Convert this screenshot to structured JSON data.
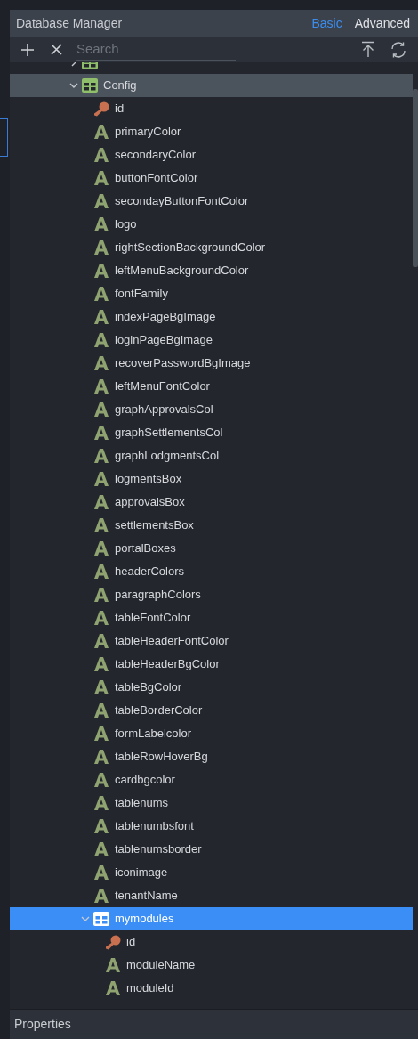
{
  "panel": {
    "title": "Database Manager"
  },
  "tabs": [
    {
      "label": "Basic",
      "selected": true
    },
    {
      "label": "Advanced",
      "selected": false
    }
  ],
  "search": {
    "placeholder": "Search"
  },
  "tree": [
    {
      "kind": "table",
      "expanded": false,
      "selected": false,
      "highlighted": false
    },
    {
      "kind": "table",
      "label": "Config",
      "expanded": true,
      "selected": false,
      "highlighted": true,
      "children": [
        {
          "kind": "key",
          "label": "id"
        },
        {
          "kind": "text",
          "label": "primaryColor"
        },
        {
          "kind": "text",
          "label": "secondaryColor"
        },
        {
          "kind": "text",
          "label": "buttonFontColor"
        },
        {
          "kind": "text",
          "label": "secondayButtonFontColor"
        },
        {
          "kind": "text",
          "label": "logo"
        },
        {
          "kind": "text",
          "label": "rightSectionBackgroundColor"
        },
        {
          "kind": "text",
          "label": "leftMenuBackgroundColor"
        },
        {
          "kind": "text",
          "label": "fontFamily"
        },
        {
          "kind": "text",
          "label": "indexPageBgImage"
        },
        {
          "kind": "text",
          "label": "loginPageBgImage"
        },
        {
          "kind": "text",
          "label": "recoverPasswordBgImage"
        },
        {
          "kind": "text",
          "label": "leftMenuFontColor"
        },
        {
          "kind": "text",
          "label": "graphApprovalsCol"
        },
        {
          "kind": "text",
          "label": "graphSettlementsCol"
        },
        {
          "kind": "text",
          "label": "graphLodgmentsCol"
        },
        {
          "kind": "text",
          "label": "logmentsBox"
        },
        {
          "kind": "text",
          "label": "approvalsBox"
        },
        {
          "kind": "text",
          "label": "settlementsBox"
        },
        {
          "kind": "text",
          "label": "portalBoxes"
        },
        {
          "kind": "text",
          "label": "headerColors"
        },
        {
          "kind": "text",
          "label": "paragraphColors"
        },
        {
          "kind": "text",
          "label": "tableFontColor"
        },
        {
          "kind": "text",
          "label": "tableHeaderFontColor"
        },
        {
          "kind": "text",
          "label": "tableHeaderBgColor"
        },
        {
          "kind": "text",
          "label": "tableBgColor"
        },
        {
          "kind": "text",
          "label": "tableBorderColor"
        },
        {
          "kind": "text",
          "label": "formLabelcolor"
        },
        {
          "kind": "text",
          "label": "tableRowHoverBg"
        },
        {
          "kind": "text",
          "label": "cardbgcolor"
        },
        {
          "kind": "text",
          "label": "tablenums"
        },
        {
          "kind": "text",
          "label": "tablenumbsfont"
        },
        {
          "kind": "text",
          "label": "tablenumsborder"
        },
        {
          "kind": "text",
          "label": "iconimage"
        },
        {
          "kind": "text",
          "label": "tenantName"
        },
        {
          "kind": "table",
          "label": "mymodules",
          "expanded": true,
          "selected": true,
          "children": [
            {
              "kind": "key",
              "label": "id"
            },
            {
              "kind": "text",
              "label": "moduleName"
            },
            {
              "kind": "text",
              "label": "moduleId"
            }
          ]
        }
      ]
    }
  ],
  "footer": {
    "title": "Properties"
  }
}
